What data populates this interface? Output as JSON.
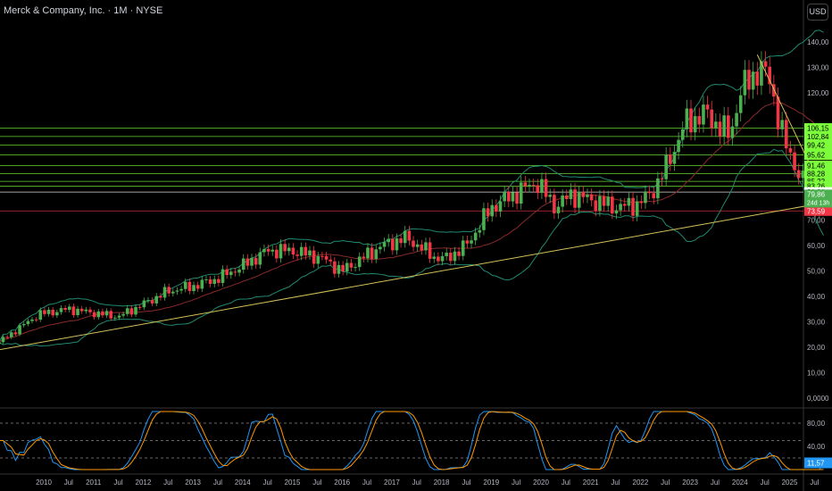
{
  "header": {
    "title": "Merck & Company, Inc. · 1M · NYSE",
    "currency_button": "USD"
  },
  "chart_data": {
    "type": "candlestick",
    "symbol": "MRK",
    "interval": "1M",
    "exchange": "NYSE",
    "price_ticks": [
      "140,00",
      "130,00",
      "120,00",
      "70,00",
      "60,00",
      "50,00",
      "40,00",
      "30,00",
      "20,00",
      "10,00",
      "0,0000"
    ],
    "price_tick_values": [
      140,
      130,
      120,
      70,
      60,
      50,
      40,
      30,
      20,
      10,
      0
    ],
    "ylim": [
      0,
      145
    ],
    "x_labels": [
      "2010",
      "Jul",
      "2011",
      "Jul",
      "2012",
      "Jul",
      "2013",
      "Jul",
      "2014",
      "Jul",
      "2015",
      "Jul",
      "2016",
      "Jul",
      "2017",
      "Jul",
      "2018",
      "Jul",
      "2019",
      "Jul",
      "2020",
      "Jul",
      "2021",
      "Jul",
      "2022",
      "Jul",
      "2023",
      "Jul",
      "2024",
      "Jul",
      "2025",
      "Jul"
    ],
    "close_keypoints": [
      [
        2009.1,
        22
      ],
      [
        2009.9,
        33
      ],
      [
        2010.5,
        35
      ],
      [
        2011.5,
        32
      ],
      [
        2012.0,
        37
      ],
      [
        2012.5,
        42
      ],
      [
        2013.0,
        44
      ],
      [
        2013.5,
        47
      ],
      [
        2014.0,
        52
      ],
      [
        2014.5,
        58
      ],
      [
        2015.0,
        58
      ],
      [
        2015.6,
        55
      ],
      [
        2016.0,
        50
      ],
      [
        2016.8,
        60
      ],
      [
        2017.3,
        63
      ],
      [
        2017.9,
        55
      ],
      [
        2018.1,
        55
      ],
      [
        2018.5,
        60
      ],
      [
        2019.0,
        75
      ],
      [
        2019.9,
        85
      ],
      [
        2020.3,
        75
      ],
      [
        2020.6,
        80
      ],
      [
        2021.0,
        78
      ],
      [
        2021.5,
        75
      ],
      [
        2021.9,
        76
      ],
      [
        2022.2,
        80
      ],
      [
        2022.5,
        90
      ],
      [
        2022.9,
        108
      ],
      [
        2023.3,
        112
      ],
      [
        2023.8,
        103
      ],
      [
        2024.0,
        120
      ],
      [
        2024.4,
        130
      ],
      [
        2024.6,
        125
      ],
      [
        2024.9,
        100
      ],
      [
        2025.2,
        88
      ],
      [
        2025.5,
        77
      ],
      [
        2025.7,
        79.86
      ]
    ],
    "horizontal_levels": [
      {
        "value": 106.15,
        "label": "106,15",
        "color": "#7cfc3a"
      },
      {
        "value": 102.84,
        "label": "102,84",
        "color": "#7cfc3a"
      },
      {
        "value": 99.42,
        "label": "99,42",
        "color": "#7cfc3a"
      },
      {
        "value": 95.62,
        "label": "95,62",
        "color": "#7cfc3a"
      },
      {
        "value": 91.46,
        "label": "91,46",
        "color": "#7cfc3a"
      },
      {
        "value": 88.28,
        "label": "88,28",
        "color": "#7cfc3a"
      },
      {
        "value": 85.22,
        "label": "85,22",
        "color": "#7cfc3a"
      },
      {
        "value": 83.26,
        "label": "83,26",
        "color": "#7cfc3a"
      },
      {
        "value": 81.01,
        "label": "81,01",
        "color": "#ffffff"
      },
      {
        "value": 73.59,
        "label": "73,59",
        "color": "#f23645"
      }
    ],
    "last_price": {
      "value": 79.86,
      "label": "79,86",
      "countdown": "24d 13h",
      "color": "#4caf50"
    },
    "trendlines": [
      {
        "from": [
          2009.1,
          19
        ],
        "to": [
          2025.75,
          77
        ],
        "color": "#d4c25a"
      },
      {
        "from": [
          2024.35,
          135
        ],
        "to": [
          2025.75,
          78
        ],
        "color": "#d4c25a"
      }
    ],
    "indicators": {
      "bollinger": {
        "period": 20,
        "mult": 2
      },
      "stoch_rsi": {
        "ticks": [
          "80,00",
          "40,00"
        ],
        "tick_values": [
          80,
          40
        ],
        "bands": [
          80,
          50,
          20
        ],
        "k_label": "11,57",
        "k_color": "#2196f3",
        "d_color": "#ff9800"
      }
    }
  }
}
